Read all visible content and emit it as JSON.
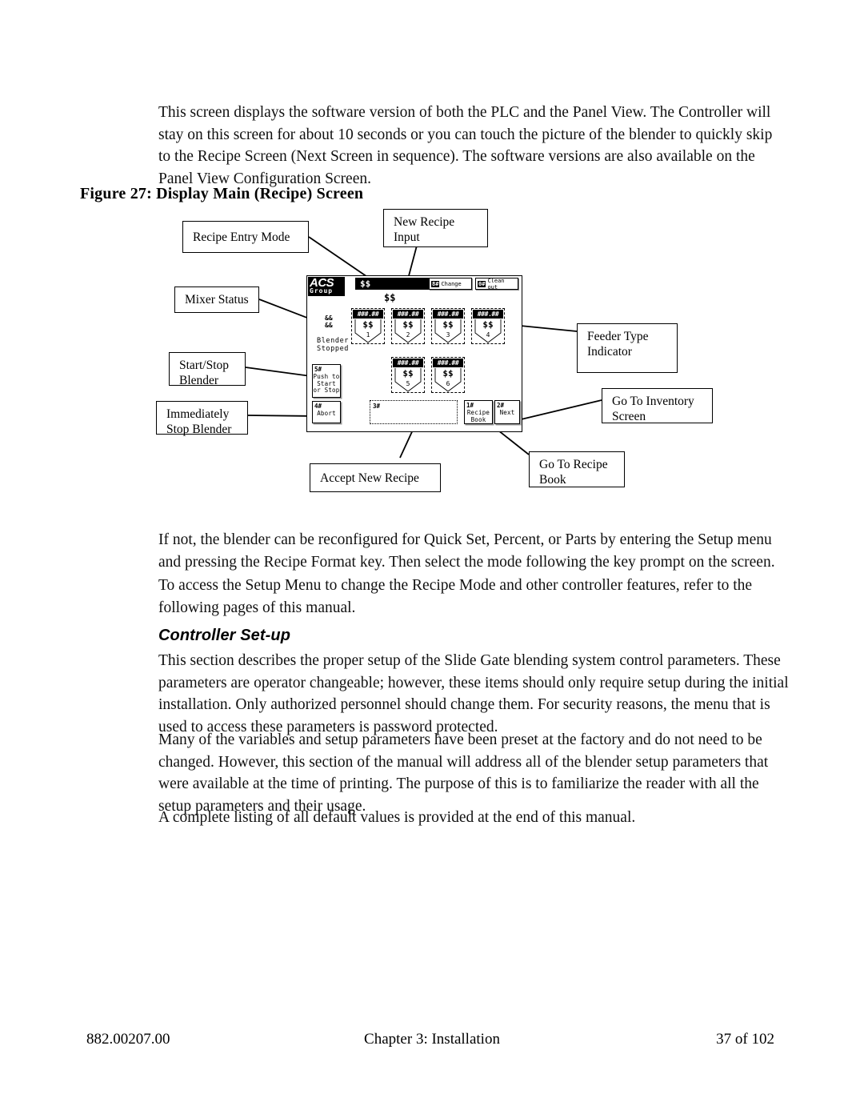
{
  "document": {
    "paragraphs": {
      "intro": "This screen displays the software version of both the PLC and the Panel View.  The Controller will stay on this screen for about 10 seconds or you can touch the picture of the blender to quickly skip to the Recipe Screen (Next Screen in sequence).  The software versions are also available on the Panel View Configuration Screen.",
      "after_figure_1": "If not, the blender can be reconfigured for Quick Set, Percent, or Parts by entering the Setup menu and pressing the Recipe Format key. Then select the mode following the key prompt on the screen.",
      "after_figure_2": "To access the Setup Menu to change the Recipe Mode and other controller features, refer to the following pages of this manual.",
      "setup_1": "This section describes the proper setup of the Slide Gate blending system control parameters. These parameters are operator changeable; however, these items should only require setup during the initial installation. Only authorized personnel should change them. For security reasons, the menu that is used to access these parameters is password protected.",
      "setup_2": "Many of the variables and setup parameters have been preset at the factory and do not need to be changed. However, this section of the manual will address all of the blender setup parameters that were available at the time of printing. The purpose of this is to familiarize the reader with all the setup parameters and their usage.",
      "setup_3": "A complete listing of all default values is provided at the end of this manual."
    },
    "figure_caption": "Figure 27: Display Main (Recipe) Screen",
    "section_heading": "Controller Set-up",
    "footer": {
      "left": "882.00207.00",
      "center": "Chapter 3: Installation",
      "right": "37 of 102"
    }
  },
  "figure": {
    "callouts": [
      {
        "id": "recipe-entry-mode",
        "text": "Recipe Entry Mode"
      },
      {
        "id": "new-recipe-input",
        "line1": "New Recipe",
        "line2": "Input"
      },
      {
        "id": "mixer-status",
        "text": "Mixer Status"
      },
      {
        "id": "start-stop-blender",
        "line1": "Start/Stop",
        "line2": "Blender"
      },
      {
        "id": "immediately-stop",
        "line1": "Immediately",
        "line2": "Stop Blender"
      },
      {
        "id": "feeder-type",
        "line1": "Feeder Type",
        "line2": "Indicator"
      },
      {
        "id": "go-to-inventory",
        "line1": "Go To Inventory",
        "line2": "Screen"
      },
      {
        "id": "accept-new-recipe",
        "text": "Accept New Recipe"
      },
      {
        "id": "go-to-recipe-book",
        "line1": "Go To Recipe",
        "line2": "Book"
      }
    ],
    "panel": {
      "logo": {
        "brand": "ACS",
        "sub": "Group"
      },
      "title_value": "$$",
      "mode_sub_value": "$$",
      "top_buttons": [
        {
          "key": "8#",
          "label": "Change"
        },
        {
          "key": "0#",
          "label": "Clean out"
        }
      ],
      "mixer_pct_line1": "&&",
      "mixer_pct_line2": "&&",
      "blender_status_line1": "Blender",
      "blender_status_line2": "Stopped",
      "feeders": [
        {
          "bar": "###.##",
          "value": "$$",
          "num": "1"
        },
        {
          "bar": "###.##",
          "value": "$$",
          "num": "2"
        },
        {
          "bar": "###.##",
          "value": "$$",
          "num": "3"
        },
        {
          "bar": "###.##",
          "value": "$$",
          "num": "4"
        },
        {
          "bar": "###.##",
          "value": "$$",
          "num": "5"
        },
        {
          "bar": "###.##",
          "value": "$$",
          "num": "6"
        }
      ],
      "start_stop": {
        "key": "5#",
        "line1": "Push to",
        "line2": "Start",
        "line3": "or Stop"
      },
      "abort": {
        "key": "4#",
        "label": "Abort"
      },
      "input": {
        "key": "3#",
        "value": ""
      },
      "recipe_book": {
        "key": "1#",
        "line1": "Recipe",
        "line2": "Book"
      },
      "next": {
        "key": "2#",
        "label": "Next"
      }
    }
  },
  "colors": {
    "ink": "#000000",
    "paper": "#ffffff",
    "panel_shadow": "#c9c9c9"
  }
}
